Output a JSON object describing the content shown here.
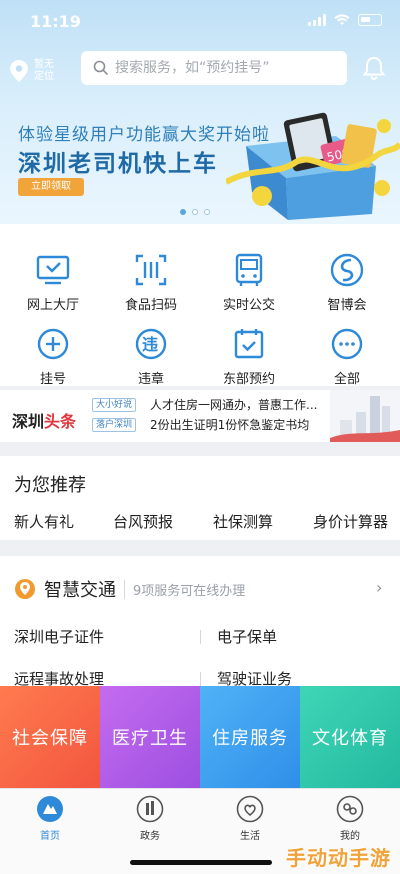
{
  "status_bar": {
    "time": "11:19"
  },
  "header": {
    "location_label": "暂无定位",
    "search_placeholder": "搜索服务，如“预约挂号”"
  },
  "banner": {
    "line1": "体验星级用户功能赢大奖开始啦",
    "line2": "深圳老司机快上车",
    "button": "立即领取",
    "page_count": 3,
    "active_page": 1,
    "prize_text": "500"
  },
  "services": [
    {
      "label": "网上大厅",
      "icon": "monitor-icon"
    },
    {
      "label": "食品扫码",
      "icon": "scan-icon"
    },
    {
      "label": "实时公交",
      "icon": "bus-icon"
    },
    {
      "label": "智博会",
      "icon": "expo-logo-icon"
    },
    {
      "label": "挂号",
      "icon": "medical-cross-icon"
    },
    {
      "label": "违章",
      "icon": "violation-icon"
    },
    {
      "label": "东部预约",
      "icon": "calendar-check-icon"
    },
    {
      "label": "全部",
      "icon": "more-dots-icon"
    }
  ],
  "news": {
    "brand_left": "深圳",
    "brand_right": "头条",
    "items": [
      {
        "tag": "大小好说",
        "text": "人才住房一网通办，普惠工作..."
      },
      {
        "tag": "落户深圳",
        "text": "2份出生证明1份怀急鉴定书均"
      }
    ]
  },
  "recommend": {
    "title": "为您推荐",
    "items": [
      "新人有礼",
      "台风预报",
      "社保测算",
      "身价计算器"
    ]
  },
  "traffic": {
    "title": "智慧交通",
    "subtitle": "9项服务可在线办理",
    "items": [
      "深圳电子证件",
      "电子保单",
      "远程事故处理",
      "驾驶证业务"
    ]
  },
  "categories": [
    {
      "label": "社会保障",
      "color": "#f56a45"
    },
    {
      "label": "医疗卫生",
      "color": "#b05ce8"
    },
    {
      "label": "住房服务",
      "color": "#3aa3f0"
    },
    {
      "label": "文化体育",
      "color": "#2fc9ad"
    }
  ],
  "tabs": [
    {
      "label": "首页",
      "icon": "home-icon",
      "active": true
    },
    {
      "label": "政务",
      "icon": "government-icon",
      "active": false
    },
    {
      "label": "生活",
      "icon": "life-heart-icon",
      "active": false
    },
    {
      "label": "我的",
      "icon": "profile-icon",
      "active": false
    }
  ],
  "watermark": "手动动手游",
  "colors": {
    "accent": "#2e8ad8",
    "icon_blue": "#2e8ad8",
    "banner_button": "#f0a43a"
  }
}
